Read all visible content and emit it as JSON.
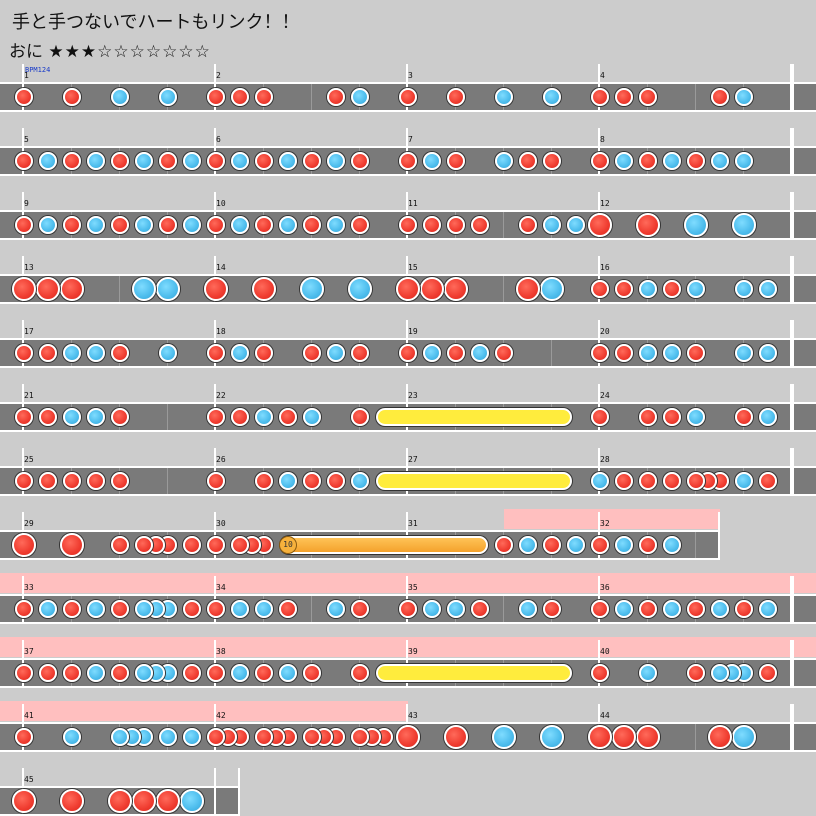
{
  "song": {
    "title": "手と手つないでハートもリンク！！",
    "difficulty": "おに",
    "stars_filled": "★★★",
    "stars_empty": "☆☆☆☆☆☆☆",
    "bpm_label": "BPM124"
  },
  "colors": {
    "don": "#ef3b2f",
    "ka": "#4cbcec",
    "roll": "#ffec3d",
    "balloon": "#f4a22c",
    "gogo": "#ffbfbf",
    "lane": "#7a7a7a"
  },
  "balloon_hits": "10",
  "chart_data": {
    "type": "table",
    "rows": [
      {
        "measures": [
          1,
          2,
          3,
          4
        ],
        "notes": [
          [
            "d",
            0
          ],
          [
            "d",
            2
          ],
          [
            "k",
            4
          ],
          [
            "k",
            6
          ],
          [
            "d",
            8
          ],
          [
            "d",
            9
          ],
          [
            "d",
            10
          ],
          [
            "d",
            13
          ],
          [
            "k",
            14
          ],
          [
            "d",
            16
          ],
          [
            "d",
            18
          ],
          [
            "k",
            20
          ],
          [
            "k",
            22
          ],
          [
            "d",
            24
          ],
          [
            "d",
            25
          ],
          [
            "d",
            26
          ],
          [
            "d",
            29
          ],
          [
            "k",
            30
          ]
        ],
        "big": true
      },
      {
        "measures": [
          5,
          6,
          7,
          8
        ],
        "notes": [
          [
            "d",
            0
          ],
          [
            "k",
            1
          ],
          [
            "d",
            2
          ],
          [
            "k",
            3
          ],
          [
            "d",
            4
          ],
          [
            "k",
            5
          ],
          [
            "d",
            6
          ],
          [
            "k",
            7
          ],
          [
            "d",
            8
          ],
          [
            "k",
            9
          ],
          [
            "d",
            10
          ],
          [
            "k",
            11
          ],
          [
            "d",
            12
          ],
          [
            "k",
            13
          ],
          [
            "d",
            14
          ],
          [
            "d",
            16
          ],
          [
            "k",
            17
          ],
          [
            "d",
            18
          ],
          [
            "k",
            20
          ],
          [
            "d",
            21
          ],
          [
            "d",
            22
          ],
          [
            "d",
            24
          ],
          [
            "k",
            25
          ],
          [
            "d",
            26
          ],
          [
            "k",
            27
          ],
          [
            "d",
            28
          ],
          [
            "k",
            29
          ],
          [
            "k",
            30
          ]
        ]
      },
      {
        "measures": [
          9,
          10,
          11,
          12
        ],
        "notes": [
          [
            "d",
            0
          ],
          [
            "k",
            1
          ],
          [
            "d",
            2
          ],
          [
            "k",
            3
          ],
          [
            "d",
            4
          ],
          [
            "k",
            5
          ],
          [
            "d",
            6
          ],
          [
            "k",
            7
          ],
          [
            "d",
            8
          ],
          [
            "k",
            9
          ],
          [
            "d",
            10
          ],
          [
            "k",
            11
          ],
          [
            "d",
            12
          ],
          [
            "k",
            13
          ],
          [
            "d",
            14
          ],
          [
            "d",
            16
          ],
          [
            "d",
            17
          ],
          [
            "d",
            18
          ],
          [
            "d",
            19
          ],
          [
            "d",
            21
          ],
          [
            "k",
            22
          ],
          [
            "k",
            23
          ],
          [
            "D",
            24
          ],
          [
            "D",
            26
          ],
          [
            "K",
            28
          ],
          [
            "K",
            30
          ]
        ]
      },
      {
        "measures": [
          13,
          14,
          15,
          16
        ],
        "notes": [
          [
            "D",
            0
          ],
          [
            "D",
            1
          ],
          [
            "D",
            2
          ],
          [
            "K",
            5
          ],
          [
            "K",
            6
          ],
          [
            "D",
            8
          ],
          [
            "D",
            10
          ],
          [
            "K",
            12
          ],
          [
            "K",
            14
          ],
          [
            "D",
            16
          ],
          [
            "D",
            17
          ],
          [
            "D",
            18
          ],
          [
            "D",
            21
          ],
          [
            "K",
            22
          ],
          [
            "d",
            24
          ],
          [
            "d",
            25
          ],
          [
            "k",
            26
          ],
          [
            "d",
            27
          ],
          [
            "k",
            28
          ],
          [
            "k",
            30
          ],
          [
            "k",
            31
          ]
        ]
      },
      {
        "measures": [
          17,
          18,
          19,
          20
        ],
        "notes": [
          [
            "d",
            0
          ],
          [
            "d",
            1
          ],
          [
            "k",
            2
          ],
          [
            "k",
            3
          ],
          [
            "d",
            4
          ],
          [
            "k",
            6
          ],
          [
            "d",
            8
          ],
          [
            "k",
            9
          ],
          [
            "d",
            10
          ],
          [
            "d",
            12
          ],
          [
            "k",
            13
          ],
          [
            "d",
            14
          ],
          [
            "d",
            16
          ],
          [
            "k",
            17
          ],
          [
            "d",
            18
          ],
          [
            "k",
            19
          ],
          [
            "d",
            20
          ],
          [
            "d",
            24
          ],
          [
            "d",
            25
          ],
          [
            "k",
            26
          ],
          [
            "k",
            27
          ],
          [
            "d",
            28
          ],
          [
            "k",
            30
          ],
          [
            "k",
            31
          ]
        ]
      },
      {
        "measures": [
          21,
          22,
          23,
          24
        ],
        "notes": [
          [
            "d",
            0
          ],
          [
            "d",
            1
          ],
          [
            "k",
            2
          ],
          [
            "k",
            3
          ],
          [
            "d",
            4
          ],
          [
            "d",
            8
          ],
          [
            "d",
            9
          ],
          [
            "k",
            10
          ],
          [
            "d",
            11
          ],
          [
            "k",
            12
          ],
          [
            "d",
            14
          ],
          [
            "d",
            24
          ],
          [
            "d",
            26
          ],
          [
            "d",
            27
          ],
          [
            "k",
            28
          ],
          [
            "d",
            30
          ],
          [
            "k",
            31
          ]
        ],
        "rolls": [
          [
            15,
            22.5
          ]
        ]
      },
      {
        "measures": [
          25,
          26,
          27,
          28
        ],
        "notes": [
          [
            "d",
            0
          ],
          [
            "d",
            1
          ],
          [
            "d",
            2
          ],
          [
            "d",
            3
          ],
          [
            "d",
            4
          ],
          [
            "d",
            8
          ],
          [
            "d",
            10
          ],
          [
            "k",
            11
          ],
          [
            "d",
            12
          ],
          [
            "d",
            13
          ],
          [
            "k",
            14
          ],
          [
            "k",
            24
          ],
          [
            "d",
            25
          ],
          [
            "d",
            26
          ],
          [
            "d",
            27
          ],
          [
            "d",
            28
          ],
          [
            "d",
            28.5
          ],
          [
            "d",
            29
          ],
          [
            "k",
            30
          ],
          [
            "d",
            31
          ]
        ],
        "rolls": [
          [
            15,
            22.5
          ]
        ]
      },
      {
        "measures": [
          29,
          30,
          31,
          32
        ],
        "notes": [
          [
            "D",
            0
          ],
          [
            "D",
            2
          ],
          [
            "d",
            4
          ],
          [
            "d",
            5
          ],
          [
            "d",
            5.5
          ],
          [
            "d",
            6
          ],
          [
            "d",
            7
          ],
          [
            "d",
            8
          ],
          [
            "d",
            9
          ],
          [
            "d",
            9.5
          ],
          [
            "d",
            10
          ],
          [
            "d",
            20
          ],
          [
            "k",
            21
          ],
          [
            "d",
            22
          ],
          [
            "k",
            23
          ],
          [
            "d",
            24
          ],
          [
            "k",
            25
          ],
          [
            "d",
            26
          ],
          [
            "k",
            27
          ]
        ],
        "balloon": [
          11,
          19
        ]
      },
      {
        "measures": [
          33,
          34,
          35,
          36
        ],
        "notes": [
          [
            "d",
            0
          ],
          [
            "k",
            1
          ],
          [
            "d",
            2
          ],
          [
            "k",
            3
          ],
          [
            "d",
            4
          ],
          [
            "k",
            5
          ],
          [
            "k",
            5.5
          ],
          [
            "k",
            6
          ],
          [
            "d",
            7
          ],
          [
            "d",
            8
          ],
          [
            "k",
            9
          ],
          [
            "k",
            10
          ],
          [
            "d",
            11
          ],
          [
            "k",
            13
          ],
          [
            "d",
            14
          ],
          [
            "d",
            16
          ],
          [
            "k",
            17
          ],
          [
            "k",
            18
          ],
          [
            "d",
            19
          ],
          [
            "k",
            21
          ],
          [
            "d",
            22
          ],
          [
            "d",
            24
          ],
          [
            "k",
            25
          ],
          [
            "d",
            26
          ],
          [
            "k",
            27
          ],
          [
            "d",
            28
          ],
          [
            "k",
            29
          ],
          [
            "d",
            30
          ],
          [
            "k",
            31
          ]
        ]
      },
      {
        "measures": [
          37,
          38,
          39,
          40
        ],
        "notes": [
          [
            "d",
            0
          ],
          [
            "d",
            1
          ],
          [
            "d",
            2
          ],
          [
            "k",
            3
          ],
          [
            "d",
            4
          ],
          [
            "k",
            5
          ],
          [
            "k",
            5.5
          ],
          [
            "k",
            6
          ],
          [
            "d",
            7
          ],
          [
            "d",
            8
          ],
          [
            "k",
            9
          ],
          [
            "d",
            10
          ],
          [
            "k",
            11
          ],
          [
            "d",
            12
          ],
          [
            "d",
            14
          ],
          [
            "d",
            24
          ],
          [
            "k",
            26
          ],
          [
            "d",
            28
          ],
          [
            "k",
            29
          ],
          [
            "k",
            29.5
          ],
          [
            "k",
            30
          ],
          [
            "d",
            31
          ]
        ],
        "rolls": [
          [
            15,
            22.5
          ]
        ]
      },
      {
        "measures": [
          41,
          42,
          43,
          44
        ],
        "notes": [
          [
            "d",
            0
          ],
          [
            "k",
            2
          ],
          [
            "k",
            4
          ],
          [
            "k",
            4.5
          ],
          [
            "k",
            5
          ],
          [
            "k",
            6
          ],
          [
            "k",
            7
          ],
          [
            "d",
            8
          ],
          [
            "d",
            8.5
          ],
          [
            "d",
            9
          ],
          [
            "d",
            10
          ],
          [
            "d",
            10.5
          ],
          [
            "d",
            11
          ],
          [
            "d",
            12
          ],
          [
            "d",
            12.5
          ],
          [
            "d",
            13
          ],
          [
            "d",
            14
          ],
          [
            "d",
            14.5
          ],
          [
            "d",
            15
          ],
          [
            "D",
            16
          ],
          [
            "D",
            18
          ],
          [
            "K",
            20
          ],
          [
            "K",
            22
          ],
          [
            "D",
            24
          ],
          [
            "D",
            25
          ],
          [
            "D",
            26
          ],
          [
            "D",
            29
          ],
          [
            "K",
            30
          ]
        ]
      },
      {
        "measures": [
          45
        ],
        "notes": [
          [
            "D",
            0
          ],
          [
            "D",
            2
          ],
          [
            "D",
            4
          ],
          [
            "D",
            5
          ],
          [
            "D",
            6
          ],
          [
            "K",
            7
          ]
        ]
      }
    ]
  }
}
